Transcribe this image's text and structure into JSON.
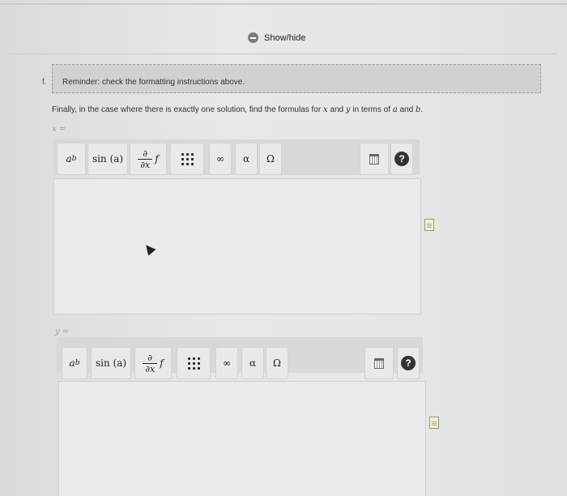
{
  "header": {
    "show_hide_label": "Show/hide"
  },
  "question": {
    "number": "f.",
    "reminder": "Reminder: check the formatting instructions above.",
    "prompt_prefix": "Finally, in the case where there is exactly one solution, find the formulas for ",
    "prompt_x": "x",
    "prompt_mid": " and ",
    "prompt_y": "y",
    "prompt_mid2": " in terms of ",
    "prompt_a": "a",
    "prompt_mid3": " and ",
    "prompt_b": "b",
    "prompt_end": "."
  },
  "answers": [
    {
      "label": "x ="
    },
    {
      "label": "y ="
    }
  ],
  "toolbar": {
    "power_base": "a",
    "power_exp": "b",
    "sin_label": "sin (a)",
    "partial_top": "∂",
    "partial_bottom": "∂x",
    "partial_f": "f",
    "infinity": "∞",
    "alpha": "α",
    "omega": "Ω",
    "help": "?"
  },
  "icons": [
    "minus-circle-icon",
    "matrix-icon",
    "trash-icon",
    "help-icon",
    "document-icon",
    "cursor-arrow-icon"
  ]
}
